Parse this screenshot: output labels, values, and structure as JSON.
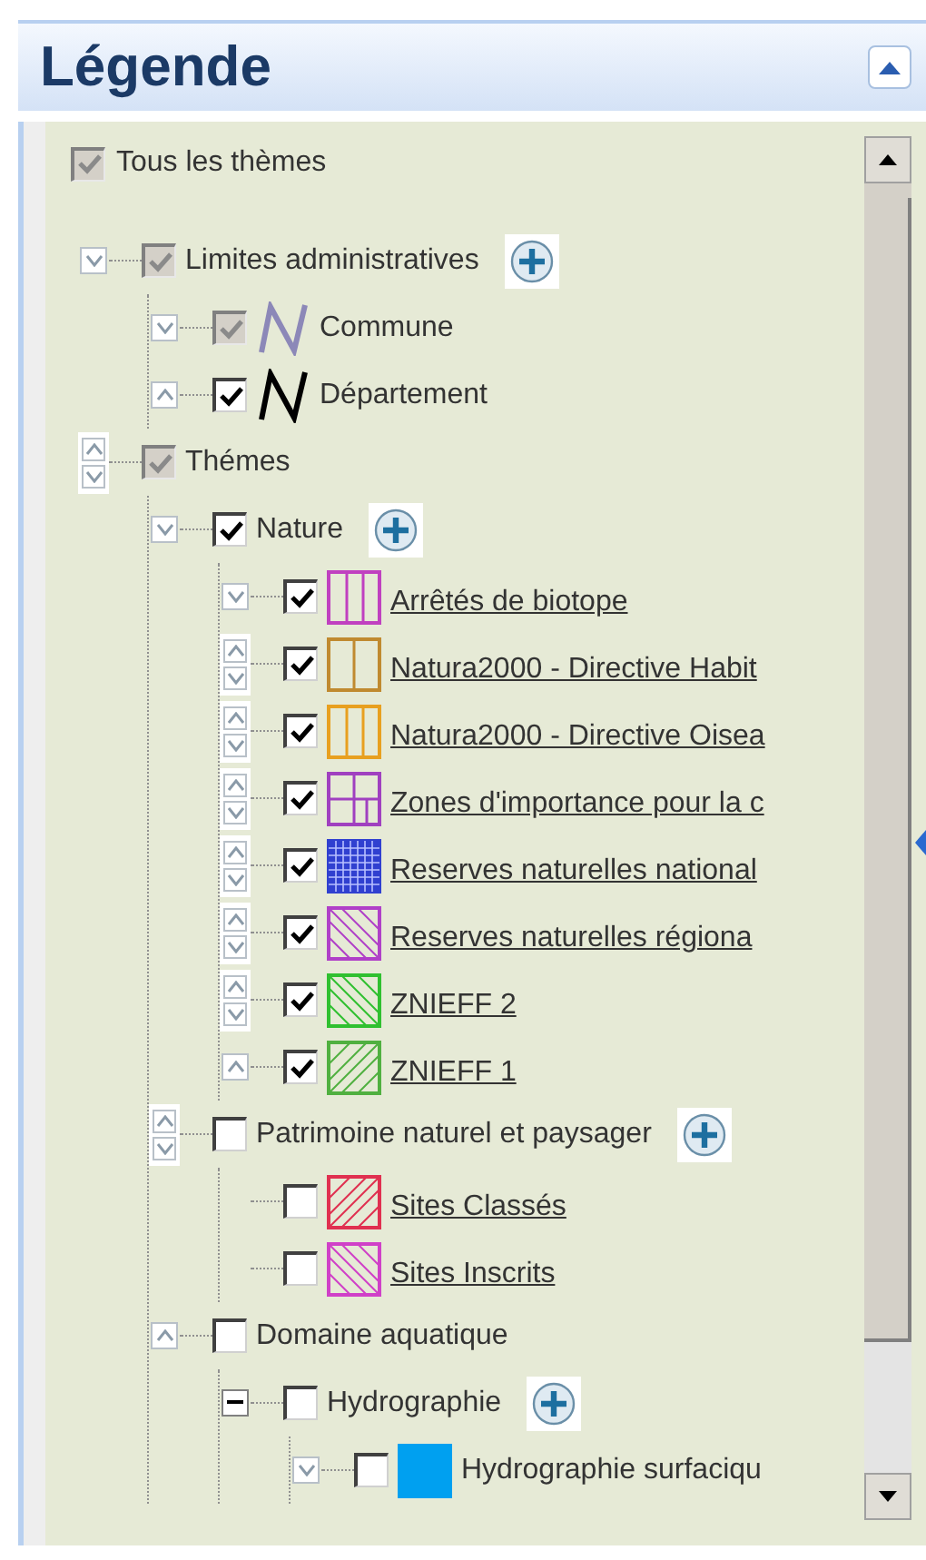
{
  "header": {
    "title": "Légende"
  },
  "tree": {
    "label": "Tous les thèmes",
    "checked": true,
    "disabled": true,
    "children": [
      {
        "label": "Limites administratives",
        "toggle": {
          "kind": "down"
        },
        "checked": true,
        "disabled": true,
        "add": true,
        "children": [
          {
            "label": "Commune",
            "toggle": {
              "kind": "down"
            },
            "checked": true,
            "disabled": true,
            "symbol": {
              "kind": "line",
              "color": "#8c88b8"
            }
          },
          {
            "label": "Département",
            "toggle": {
              "kind": "up"
            },
            "checked": true,
            "disabled": false,
            "symbol": {
              "kind": "line",
              "color": "#000000"
            }
          }
        ]
      },
      {
        "label": "Thémes",
        "toggle": {
          "kind": "updown"
        },
        "checked": true,
        "disabled": true,
        "children": [
          {
            "label": "Nature",
            "toggle": {
              "kind": "down"
            },
            "checked": true,
            "disabled": false,
            "add": true,
            "children": [
              {
                "label": "Arrêtés de biotope",
                "toggle": {
                  "kind": "down"
                },
                "checked": true,
                "disabled": false,
                "link": true,
                "symbol": {
                  "kind": "vlines",
                  "color": "#c040c0"
                }
              },
              {
                "label": "Natura2000 - Directive Habit",
                "toggle": {
                  "kind": "updown"
                },
                "checked": true,
                "disabled": false,
                "link": true,
                "symbol": {
                  "kind": "vline",
                  "color": "#c08a30"
                }
              },
              {
                "label": "Natura2000 - Directive Oisea",
                "toggle": {
                  "kind": "updown"
                },
                "checked": true,
                "disabled": false,
                "link": true,
                "symbol": {
                  "kind": "vlines",
                  "color": "#e8a020"
                }
              },
              {
                "label": "Zones d'importance pour la c",
                "toggle": {
                  "kind": "updown"
                },
                "checked": true,
                "disabled": false,
                "link": true,
                "symbol": {
                  "kind": "grid",
                  "color": "#a040c0"
                }
              },
              {
                "label": "Reserves naturelles national",
                "toggle": {
                  "kind": "updown"
                },
                "checked": true,
                "disabled": false,
                "link": true,
                "symbol": {
                  "kind": "dots",
                  "color": "#3040d0"
                }
              },
              {
                "label": "Reserves naturelles régiona",
                "toggle": {
                  "kind": "updown"
                },
                "checked": true,
                "disabled": false,
                "link": true,
                "symbol": {
                  "kind": "hatch-down",
                  "color": "#b040c8"
                }
              },
              {
                "label": "ZNIEFF 2",
                "toggle": {
                  "kind": "updown"
                },
                "checked": true,
                "disabled": false,
                "link": true,
                "symbol": {
                  "kind": "hatch-down",
                  "color": "#30c030"
                }
              },
              {
                "label": "ZNIEFF 1",
                "toggle": {
                  "kind": "up"
                },
                "checked": true,
                "disabled": false,
                "link": true,
                "symbol": {
                  "kind": "hatch-up",
                  "color": "#50b040"
                }
              }
            ]
          },
          {
            "label": "Patrimoine naturel et paysager",
            "toggle": {
              "kind": "updown"
            },
            "checked": false,
            "disabled": false,
            "add": true,
            "children": [
              {
                "label": "Sites Classés",
                "checked": false,
                "disabled": false,
                "link": true,
                "symbol": {
                  "kind": "hatch-up",
                  "color": "#e03050"
                }
              },
              {
                "label": "Sites Inscrits",
                "checked": false,
                "disabled": false,
                "link": true,
                "symbol": {
                  "kind": "hatch-down",
                  "color": "#d040c8"
                }
              }
            ]
          },
          {
            "label": "Domaine aquatique",
            "toggle": {
              "kind": "up"
            },
            "checked": false,
            "disabled": false,
            "children": [
              {
                "label": "Hydrographie",
                "toggle": {
                  "kind": "minus"
                },
                "checked": false,
                "disabled": false,
                "add": true,
                "children": [
                  {
                    "label": "Hydrographie surfaciqu",
                    "toggle": {
                      "kind": "down"
                    },
                    "checked": false,
                    "disabled": false,
                    "symbol": {
                      "kind": "fill",
                      "color": "#00a0f0"
                    }
                  }
                ]
              }
            ]
          }
        ]
      }
    ]
  }
}
